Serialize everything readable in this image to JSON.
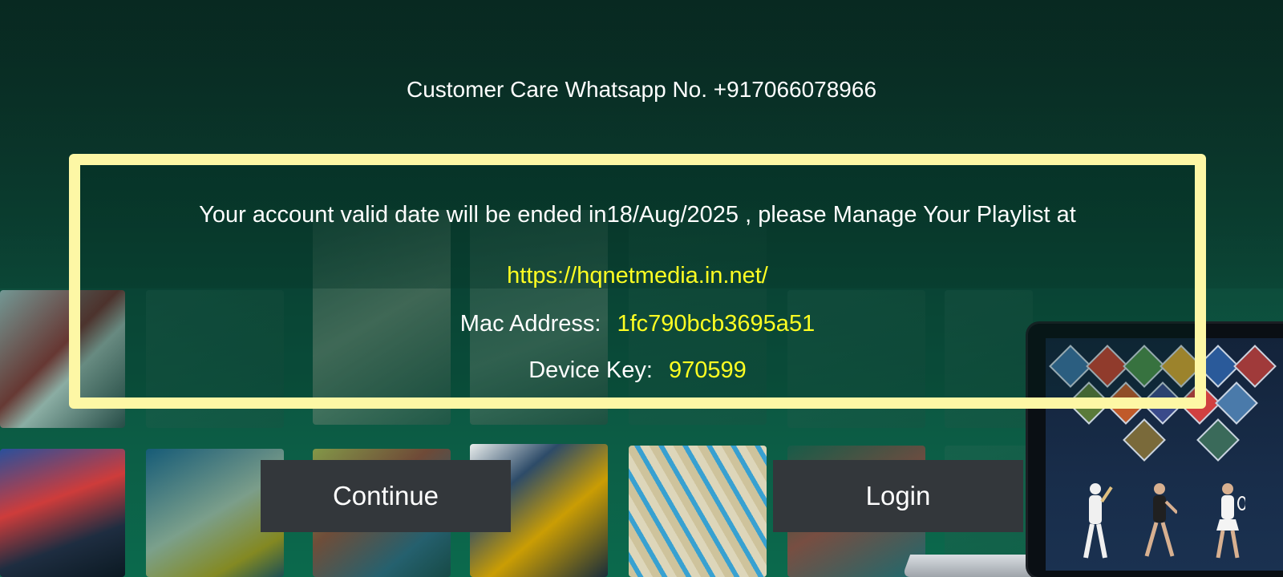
{
  "header": {
    "customer_care": "Customer Care Whatsapp No. +917066078966"
  },
  "notice": {
    "valid_message": "Your account valid date will be ended in18/Aug/2025 , please Manage Your Playlist at",
    "url": "https://hqnetmedia.in.net/",
    "mac_label": "Mac Address:",
    "mac_value": "1fc790bcb3695a51",
    "device_key_label": "Device Key:",
    "device_key_value": "970599"
  },
  "buttons": {
    "continue_label": "Continue",
    "login_label": "Login"
  },
  "colors": {
    "background": "#0d4a3a",
    "box_border": "#fdf7a5",
    "highlight_text": "#ffff22",
    "button_bg": "#33373b"
  }
}
